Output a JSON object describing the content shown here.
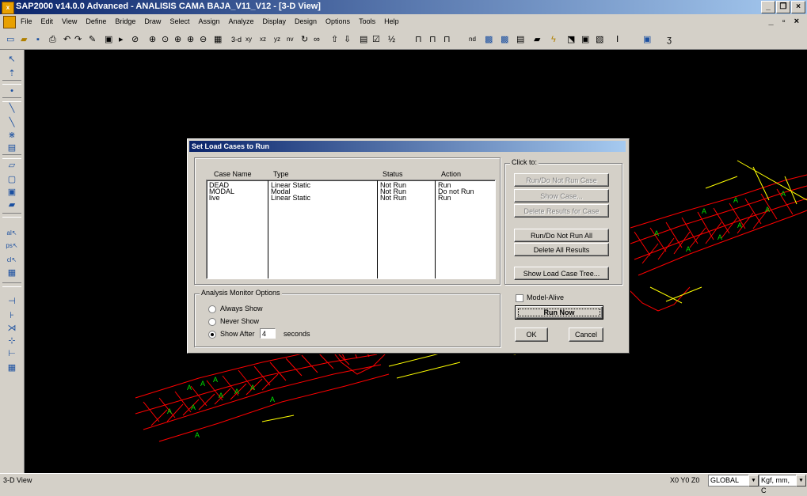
{
  "window": {
    "title": "SAP2000 v14.0.0 Advanced  - ANALISIS CAMA BAJA_V11_V12 - [3-D View]",
    "app_icon": "sap2000-icon"
  },
  "menubar": {
    "items": [
      "File",
      "Edit",
      "View",
      "Define",
      "Bridge",
      "Draw",
      "Select",
      "Assign",
      "Analyze",
      "Display",
      "Design",
      "Options",
      "Tools",
      "Help"
    ]
  },
  "toolbar": {
    "view_labels": [
      "3-d",
      "xy",
      "xz",
      "yz",
      "nv"
    ],
    "nd_label": "nd"
  },
  "dialog": {
    "title": "Set Load Cases to Run",
    "columns": [
      "Case Name",
      "Type",
      "Status",
      "Action"
    ],
    "rows": [
      {
        "case": "DEAD",
        "type": "Linear Static",
        "status": "Not Run",
        "action": "Run"
      },
      {
        "case": "MODAL",
        "type": "Modal",
        "status": "Not Run",
        "action": "Do not Run"
      },
      {
        "case": "live",
        "type": "Linear Static",
        "status": "Not Run",
        "action": "Run"
      }
    ],
    "click_to_label": "Click to:",
    "buttons": {
      "run_do_not_run_case": "Run/Do Not Run Case",
      "show_case": "Show Case...",
      "delete_results_for_case": "Delete Results for Case",
      "run_do_not_run_all": "Run/Do Not Run All",
      "delete_all_results": "Delete All Results",
      "show_load_case_tree": "Show Load Case Tree...",
      "run_now": "Run Now",
      "ok": "OK",
      "cancel": "Cancel"
    },
    "monitor": {
      "title": "Analysis Monitor Options",
      "options": [
        "Always Show",
        "Never Show",
        "Show After"
      ],
      "selected": "Show After",
      "seconds_value": "4",
      "seconds_label": "seconds"
    },
    "model_alive": {
      "label": "Model-Alive",
      "checked": false
    }
  },
  "statusbar": {
    "view_name": "3-D View",
    "coords": "X0 Y0 Z0",
    "coord_system": "GLOBAL",
    "units": "Kgf, mm, C"
  },
  "colors": {
    "frame": "#ff0000",
    "support": "#00e000",
    "area_edge": "#ffff00",
    "viewport": "#000000"
  }
}
